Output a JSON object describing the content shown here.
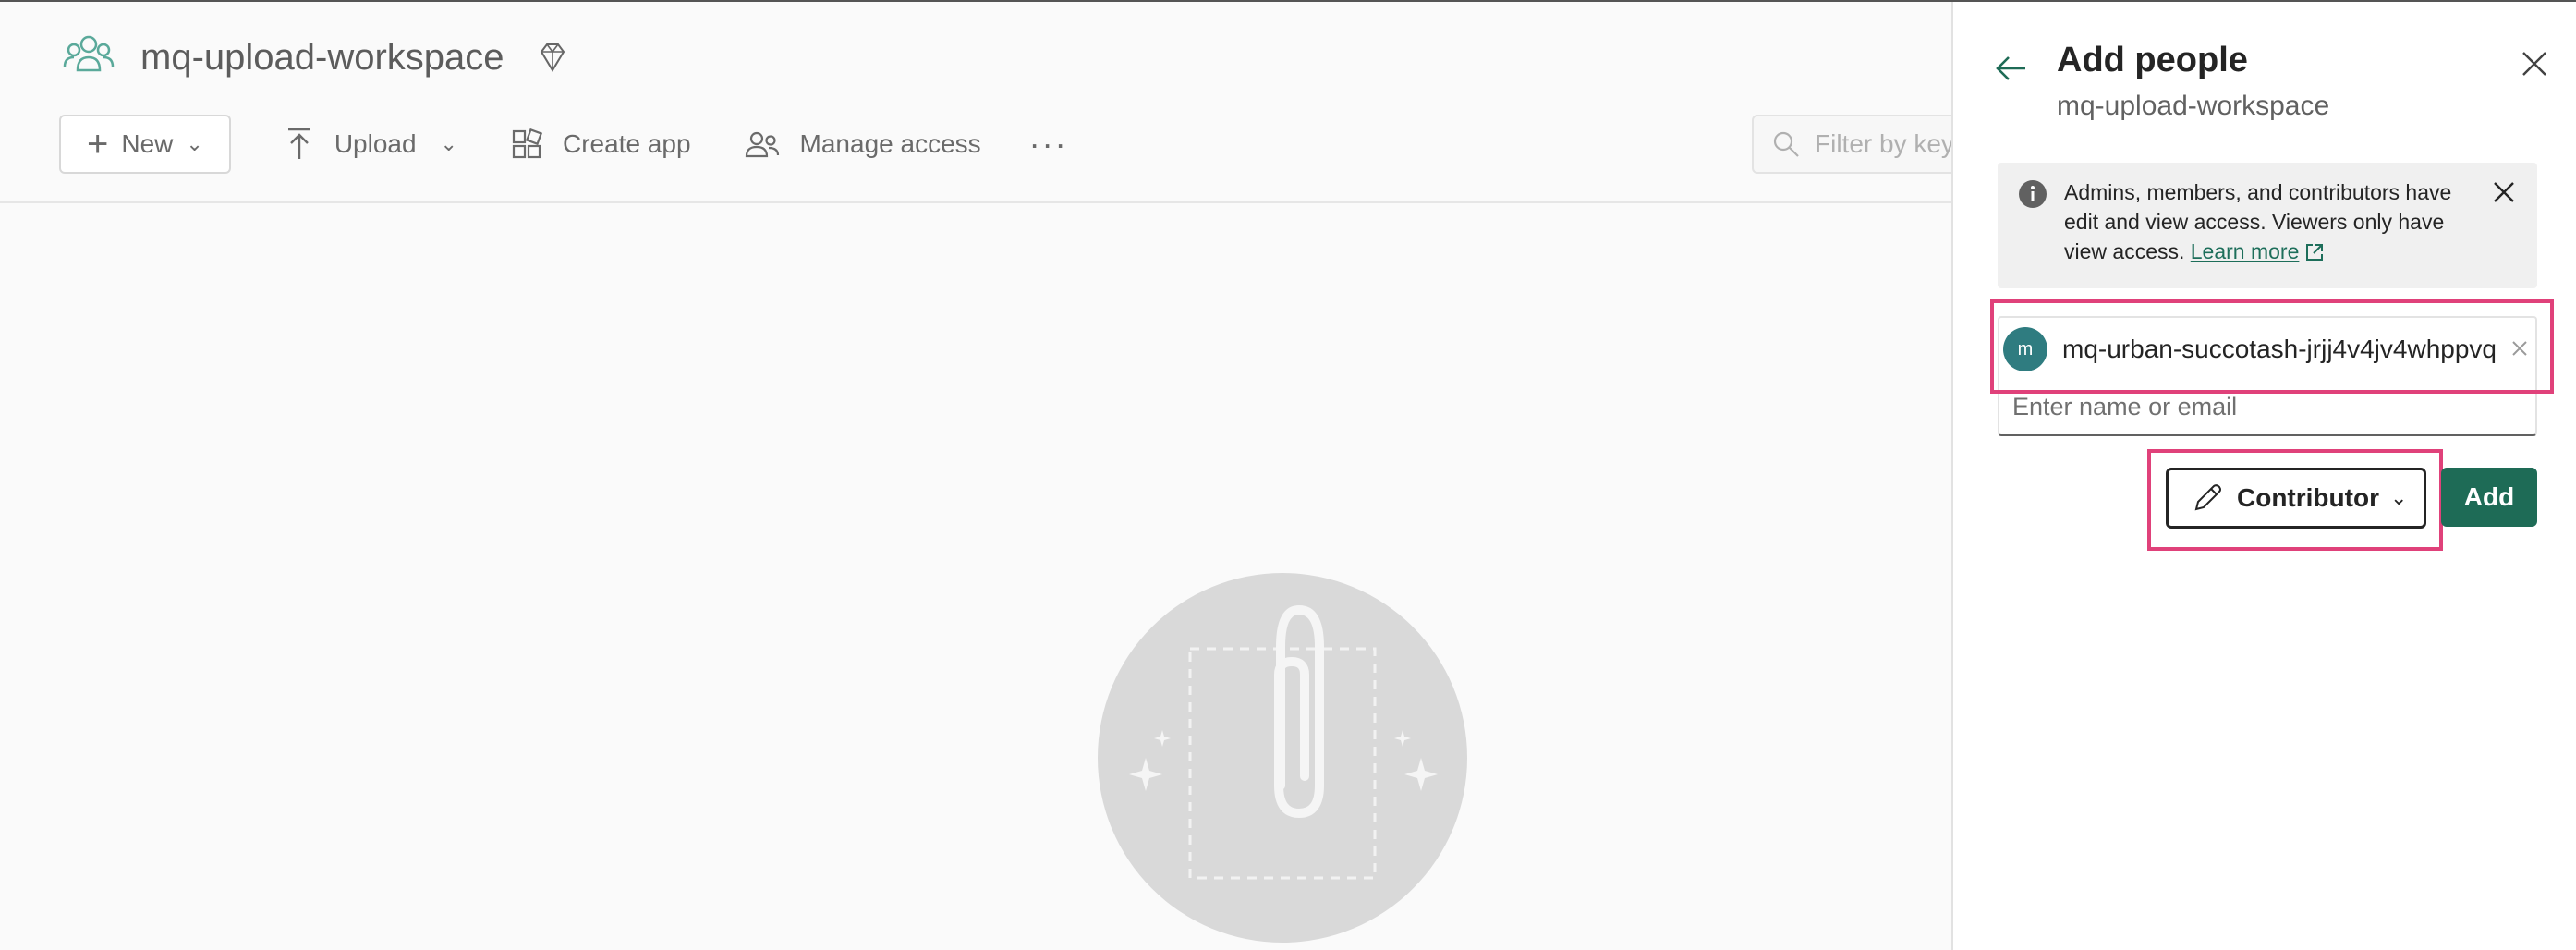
{
  "workspace": {
    "title": "mq-upload-workspace",
    "toolbar": {
      "new_label": "New",
      "upload_label": "Upload",
      "create_app_label": "Create app",
      "manage_access_label": "Manage access",
      "more_label": "···"
    },
    "filter_placeholder": "Filter by key"
  },
  "panel": {
    "title": "Add people",
    "subtitle": "mq-upload-workspace",
    "info": {
      "text": "Admins, members, and contributors have edit and view access. Viewers only have view access.",
      "link_label": "Learn more"
    },
    "selected_person": {
      "avatar_letter": "m",
      "name": "mq-urban-succotash-jrjj4v4jv4whppvq"
    },
    "input_placeholder": "Enter name or email",
    "role_label": "Contributor",
    "add_label": "Add"
  },
  "colors": {
    "accent": "#1e6b56",
    "highlight": "#e0417a",
    "avatar": "#2f7c80"
  },
  "icons": [
    "workspace-icon",
    "premium-diamond-icon",
    "plus-icon",
    "upload-icon",
    "create-app-icon",
    "manage-access-icon",
    "more-icon",
    "search-icon",
    "back-arrow-icon",
    "close-icon",
    "info-icon",
    "external-link-icon",
    "remove-icon",
    "pencil-icon",
    "chevron-down-icon",
    "paperclip-illustration"
  ]
}
